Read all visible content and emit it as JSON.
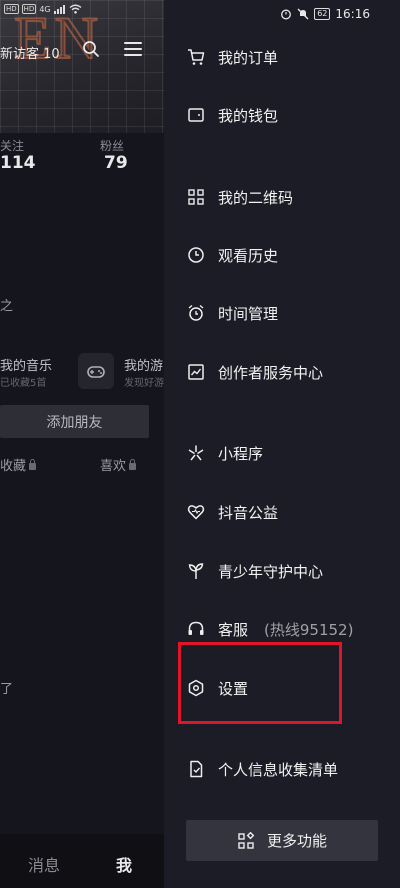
{
  "status": {
    "time": "16:16",
    "battery": "62",
    "left_tags": [
      "HD",
      "HD"
    ],
    "signal_text": "4G"
  },
  "profile_bg": {
    "visitor": "新访客 10",
    "following_label": "关注",
    "following_count": "114",
    "fans_label": "粉丝",
    "fans_count": "79",
    "stray_char": "之",
    "music_title": "我的音乐",
    "music_sub": "已收藏5首",
    "game_title": "我的游",
    "game_sub": "发现好游",
    "add_friend": "添加朋友",
    "tab_favorites": "收藏",
    "tab_likes": "喜欢",
    "stray_char2": "了",
    "nav_messages": "消息",
    "nav_me": "我"
  },
  "drawer": {
    "items": [
      {
        "label": "我的订单",
        "icon": "cart-icon"
      },
      {
        "label": "我的钱包",
        "icon": "wallet-icon"
      },
      {
        "label": "我的二维码",
        "icon": "qrcode-icon"
      },
      {
        "label": "观看历史",
        "icon": "clock-icon"
      },
      {
        "label": "时间管理",
        "icon": "alarm-icon"
      },
      {
        "label": "创作者服务中心",
        "icon": "chart-icon"
      },
      {
        "label": "小程序",
        "icon": "asterisk-icon"
      },
      {
        "label": "抖音公益",
        "icon": "heart-icon"
      },
      {
        "label": "青少年守护中心",
        "icon": "sprout-icon"
      },
      {
        "label": "客服",
        "sub": "(热线95152)",
        "icon": "headset-icon"
      },
      {
        "label": "设置",
        "icon": "hexagon-gear-icon"
      },
      {
        "label": "个人信息收集清单",
        "icon": "document-icon"
      }
    ],
    "more_label": "更多功能"
  },
  "colors": {
    "highlight": "#e0152a",
    "drawer_bg": "#1c1c26"
  }
}
